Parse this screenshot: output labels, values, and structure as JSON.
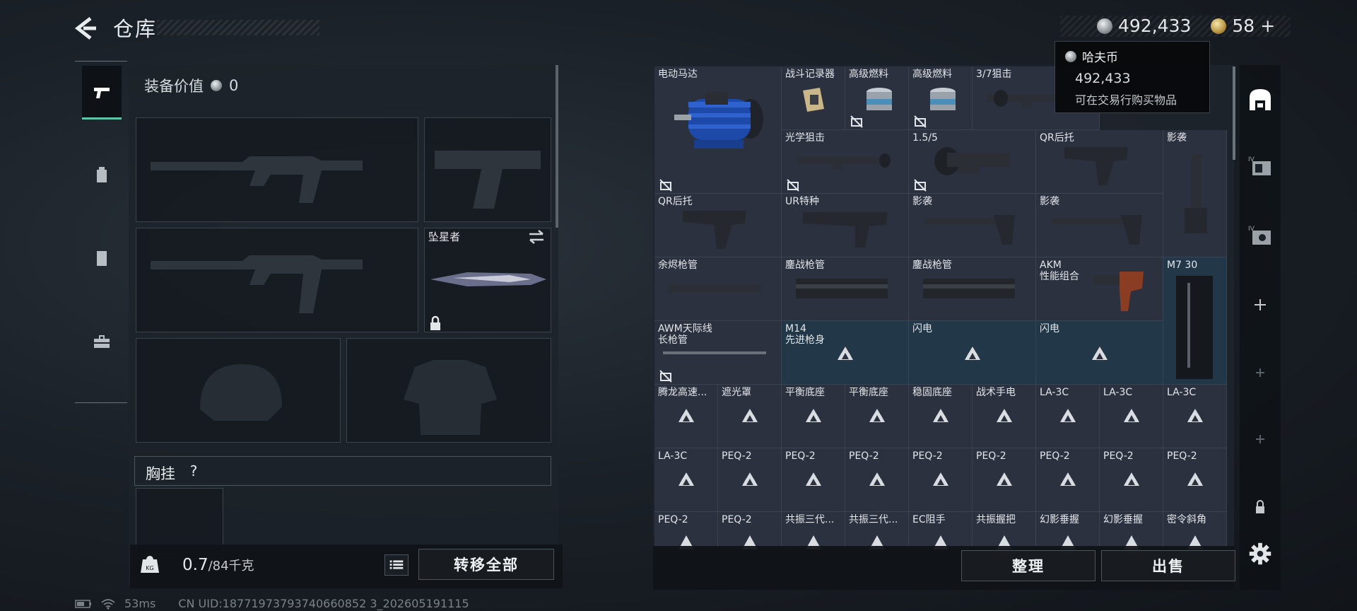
{
  "header": {
    "title": "仓库",
    "currency_amount": "492,433",
    "premium_amount": "58",
    "premium_plus": "+"
  },
  "left": {
    "equip_value_label": "装备价值",
    "equip_value": "0",
    "melee_label": "坠星者",
    "chest_rig_label": "胸挂",
    "chest_rig_help": "?",
    "weight_value": "0.7",
    "weight_max": "/84千克",
    "transfer_all": "转移全部"
  },
  "status": {
    "ping": "53ms",
    "uid": "CN UID:18771973793740660852 3_202605191115"
  },
  "tooltip": {
    "title": "哈夫币",
    "amount": "492,433",
    "desc": "可在交易行购买物品"
  },
  "inventory": {
    "sort_button": "整理",
    "sell_button": "出售",
    "items": [
      {
        "label": "电动马达"
      },
      {
        "label": "战斗记录器"
      },
      {
        "label": "高级燃料"
      },
      {
        "label": "高级燃料"
      },
      {
        "label": "3/7狙击"
      },
      {
        "label": "光学狙击"
      },
      {
        "label": "1.5/5"
      },
      {
        "label": "QR后托"
      },
      {
        "label": "影袭"
      },
      {
        "label": "QR后托"
      },
      {
        "label": "UR特种"
      },
      {
        "label": "影袭"
      },
      {
        "label": "影袭"
      },
      {
        "label": "余烬枪管"
      },
      {
        "label": "鏖战枪管"
      },
      {
        "label": "鏖战枪管"
      },
      {
        "label": "AKM\n性能组合"
      },
      {
        "label": "M7 30"
      },
      {
        "label": "AWM天际线\n长枪管"
      },
      {
        "label": "M14\n先进枪身"
      },
      {
        "label": "闪电"
      },
      {
        "label": "闪电"
      },
      {
        "label": "腾龙高速..."
      },
      {
        "label": "遮光罩"
      },
      {
        "label": "平衡底座"
      },
      {
        "label": "平衡底座"
      },
      {
        "label": "稳固底座"
      },
      {
        "label": "战术手电"
      },
      {
        "label": "LA-3C"
      },
      {
        "label": "LA-3C"
      },
      {
        "label": "LA-3C"
      },
      {
        "label": "LA-3C"
      },
      {
        "label": "PEQ-2"
      },
      {
        "label": "PEQ-2"
      },
      {
        "label": "PEQ-2"
      },
      {
        "label": "PEQ-2"
      },
      {
        "label": "PEQ-2"
      },
      {
        "label": "PEQ-2"
      },
      {
        "label": "PEQ-2"
      },
      {
        "label": "PEQ-2"
      },
      {
        "label": "PEQ-2"
      },
      {
        "label": "PEQ-2"
      },
      {
        "label": "共振三代..."
      },
      {
        "label": "共振三代..."
      },
      {
        "label": "EC阻手"
      },
      {
        "label": "共振握把"
      },
      {
        "label": "幻影垂握"
      },
      {
        "label": "幻影垂握"
      },
      {
        "label": "密令斜角"
      }
    ]
  }
}
